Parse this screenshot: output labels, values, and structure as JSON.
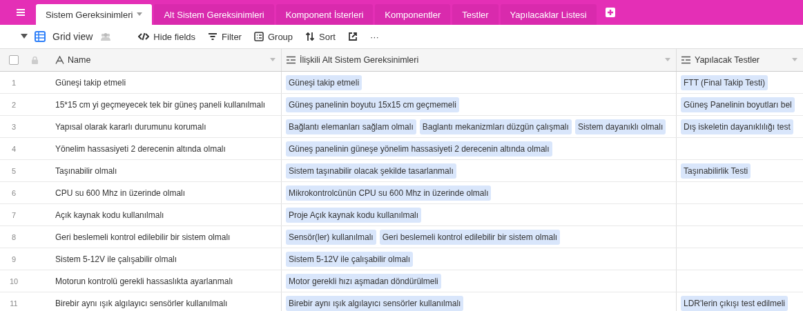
{
  "tabs": [
    {
      "label": "Sistem Gereksinimleri",
      "selected": true
    },
    {
      "label": "Alt Sistem Gereksinimleri",
      "selected": false
    },
    {
      "label": "Komponent İsterleri",
      "selected": false
    },
    {
      "label": "Komponentler",
      "selected": false
    },
    {
      "label": "Testler",
      "selected": false
    },
    {
      "label": "Yapılacaklar Listesi",
      "selected": false
    }
  ],
  "toolbar": {
    "view": "Grid view",
    "items": [
      {
        "kind": "hide",
        "label": "Hide fields"
      },
      {
        "kind": "filter",
        "label": "Filter"
      },
      {
        "kind": "group",
        "label": "Group"
      },
      {
        "kind": "sort",
        "label": "Sort"
      },
      {
        "kind": "share"
      },
      {
        "kind": "more",
        "label": "···"
      }
    ]
  },
  "table": {
    "all_checked": false,
    "columns": [
      {
        "kind": "text",
        "label": "Name"
      },
      {
        "kind": "link",
        "label": "İlişkili Alt Sistem Gereksinimleri"
      },
      {
        "kind": "link",
        "label": "Yapılacak Testler"
      }
    ],
    "rows": [
      {
        "number": "1",
        "name": "Güneşi takip etmeli",
        "links": [
          "Güneşi takip etmeli"
        ],
        "tests": [
          "FTT (Final Takip Testi)"
        ]
      },
      {
        "number": "2",
        "name": "15*15 cm yi geçmeyecek tek bir güneş paneli kullanılmalı",
        "links": [
          "Güneş panelinin boyutu 15x15 cm geçmemeli"
        ],
        "tests": [
          "Güneş Panelinin boyutları bel"
        ]
      },
      {
        "number": "3",
        "name": "Yapısal olarak kararlı durumunu korumalı",
        "links": [
          "Bağlantı elemanları sağlam olmalı",
          "Baglantı mekanizmları düzgün çalışmalı",
          "Sistem dayanıklı olmalı"
        ],
        "tests": [
          "Dış iskeletin dayanıklılığı test"
        ]
      },
      {
        "number": "4",
        "name": "Yönelim hassasiyeti 2 derecenin altında olmalı",
        "links": [
          "Güneş panelinin güneşe yönelim hassasiyeti 2 derecenin altında olmalı"
        ],
        "tests": []
      },
      {
        "number": "5",
        "name": "Taşınabilir olmalı",
        "links": [
          "Sistem taşınabilir olacak şekilde tasarlanmalı"
        ],
        "tests": [
          "Taşınabilirlik Testi"
        ]
      },
      {
        "number": "6",
        "name": "CPU su 600 Mhz in üzerinde olmalı",
        "links": [
          "Mikrokontrolcünün CPU su 600 Mhz in üzerinde olmalı"
        ],
        "tests": []
      },
      {
        "number": "7",
        "name": "Açık kaynak kodu kullanılmalı",
        "links": [
          "Proje Açık kaynak kodu kullanılmalı"
        ],
        "tests": []
      },
      {
        "number": "8",
        "name": "Geri beslemeli kontrol edilebilir bir sistem olmalı",
        "links": [
          "Sensör(ler) kullanılmalı",
          "Geri beslemeli kontrol edilebilir bir sistem olmalı"
        ],
        "tests": []
      },
      {
        "number": "9",
        "name": "Sistem 5-12V ile çalışabilir olmalı",
        "links": [
          "Sistem 5-12V ile çalışabilir olmalı"
        ],
        "tests": []
      },
      {
        "number": "10",
        "name": "Motorun kontrolü gerekli hassaslıkta ayarlanmalı",
        "links": [
          "Motor gerekli hızı aşmadan döndürülmeli"
        ],
        "tests": []
      },
      {
        "number": "11",
        "name": "Birebir aynı ışık algılayıcı sensörler kullanılmalı",
        "links": [
          "Birebir aynı ışık algılayıcı sensörler kullanılmalı"
        ],
        "tests": [
          "LDR'lerin çıkışı test edilmeli"
        ]
      }
    ]
  }
}
